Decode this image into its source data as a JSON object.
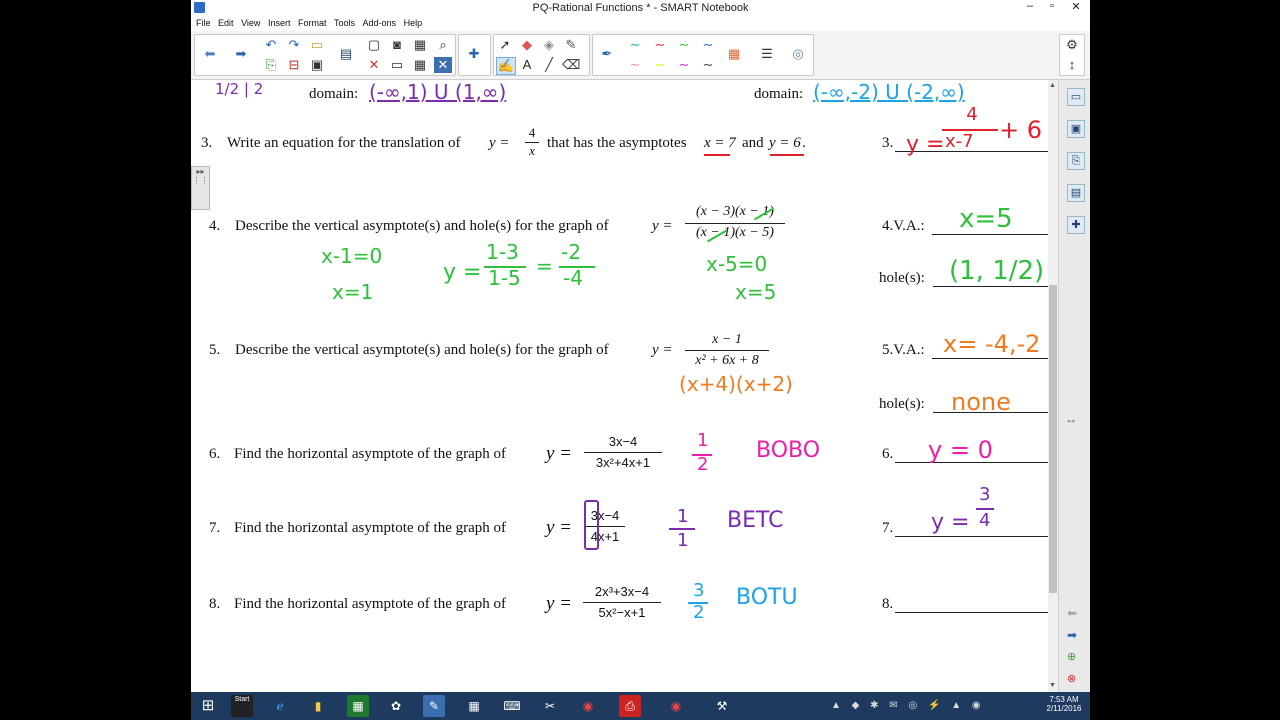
{
  "window": {
    "title": "PQ-Rational Functions * - SMART Notebook"
  },
  "menu": [
    "File",
    "Edit",
    "View",
    "Insert",
    "Format",
    "Tools",
    "Add-ons",
    "Help"
  ],
  "top": {
    "domain_label_left": "domain:",
    "domain_value_left": "(-∞,1) U (1,∞)",
    "domain_label_right": "domain:",
    "domain_value_right": "(-∞,-2) U (-2,∞)",
    "left_margin_hw": "1/2 | 2"
  },
  "q3": {
    "num": "3.",
    "text_a": "Write an equation for the translation of",
    "y_eq": "y =",
    "frac_num": "4",
    "frac_den": "x",
    "text_b": "that has the asymptotes",
    "asym1": "x = 7",
    "and": "and",
    "asym2": "y = 6",
    "end": ".",
    "ans_label": "3.",
    "ans_hw_y": "y =",
    "ans_hw_num": "4",
    "ans_hw_den": "x-7",
    "ans_hw_plus": "+ 6"
  },
  "q4": {
    "num": "4.",
    "text": "Describe the vertical asymptote(s) and hole(s) for the graph of",
    "y_eq": "y =",
    "frac_num": "(x − 3)(x − 1)",
    "frac_den": "(x − 1)(x − 5)",
    "va_label": "4.V.A.:",
    "va_hw": "x=5",
    "hole_label": "hole(s):",
    "hole_hw": "(1, 1/2)",
    "work1a": "x-1=0",
    "work1b": "x=1",
    "work2_y": "y =",
    "work2_n1": "1-3",
    "work2_d1": "1-5",
    "work2_eq": "=",
    "work2_n2": "-2",
    "work2_d2": "-4",
    "work3a": "x-5=0",
    "work3b": "x=5"
  },
  "q5": {
    "num": "5.",
    "text": "Describe the vertical asymptote(s) and hole(s) for the graph of",
    "y_eq": "y =",
    "frac_num": "x − 1",
    "frac_den": "x² + 6x + 8",
    "factor_hw": "(x+4)(x+2)",
    "va_label": "5.V.A.:",
    "va_hw": "x= -4,-2",
    "hole_label": "hole(s):",
    "hole_hw": "none"
  },
  "q6": {
    "num": "6.",
    "text": "Find the horizontal asymptote of the graph of",
    "y_eq": "y =",
    "frac_num": "3x−4",
    "frac_den": "3x²+4x+1",
    "work_num": "1",
    "work_den": "2",
    "rule_hw": "BOBO",
    "ans_label": "6.",
    "ans_hw": "y = 0"
  },
  "q7": {
    "num": "7.",
    "text": "Find the horizontal asymptote of the graph of",
    "y_eq": "y =",
    "frac_num": "3x−4",
    "frac_den": "4x+1",
    "work_num": "1",
    "work_den": "1",
    "rule_hw": "BETC",
    "ans_label": "7.",
    "ans_hw_y": "y =",
    "ans_hw_num": "3",
    "ans_hw_den": "4"
  },
  "q8": {
    "num": "8.",
    "text": "Find the horizontal asymptote of the graph of",
    "y_eq": "y =",
    "frac_num": "2x³+3x−4",
    "frac_den": "5x²−x+1",
    "work_num": "3",
    "work_den": "2",
    "rule_hw": "BOTU",
    "ans_label": "8."
  },
  "taskbar": {
    "start_label": "Start",
    "time": "7:53 AM",
    "date": "2/11/2016"
  },
  "colors": {
    "green": "#2ec03a",
    "red": "#e0202c",
    "blue": "#1aa3e6",
    "orange": "#f07a20",
    "pink": "#ee1fa6",
    "taskbar": "#1e3a5f"
  },
  "icons": [
    "back-arrow-icon",
    "forward-arrow-icon",
    "undo-icon",
    "redo-icon",
    "open-icon",
    "pen-icon",
    "eraser-icon",
    "settings-icon"
  ]
}
